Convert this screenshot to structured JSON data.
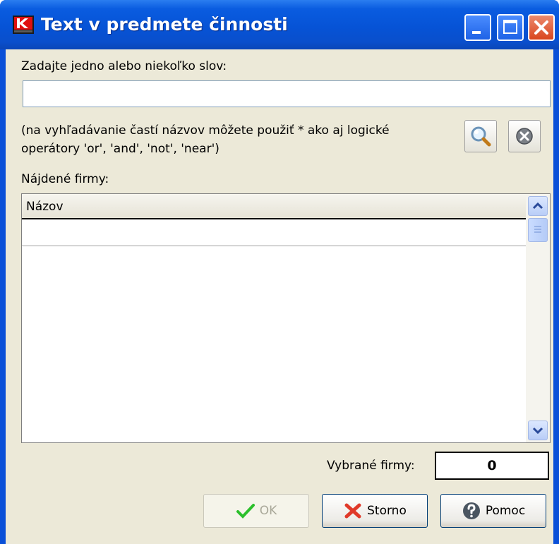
{
  "window": {
    "title": "Text v predmete činnosti"
  },
  "form": {
    "prompt_label": "Zadajte jedno alebo niekoľko slov:",
    "search_value": "",
    "hint_line1": "(na vyhľadávanie častí názvov môžete použiť * ako aj logické",
    "hint_line2": "operátory 'or', 'and', 'not', 'near')",
    "found_label": "Nájdené firmy:",
    "grid": {
      "columns": [
        "Názov"
      ],
      "rows": []
    },
    "selected_label": "Vybrané firmy:",
    "selected_count": "0"
  },
  "buttons": {
    "ok": "OK",
    "cancel": "Storno",
    "help": "Pomoc"
  },
  "icons": {
    "app": "app-logo-icon",
    "search": "magnifier-icon",
    "clear": "clear-icon",
    "ok": "checkmark-icon",
    "cancel": "red-x-icon",
    "help": "question-icon"
  },
  "colors": {
    "titlebar": "#0653d6",
    "client_bg": "#ece9d8",
    "close_button": "#d9461e"
  }
}
